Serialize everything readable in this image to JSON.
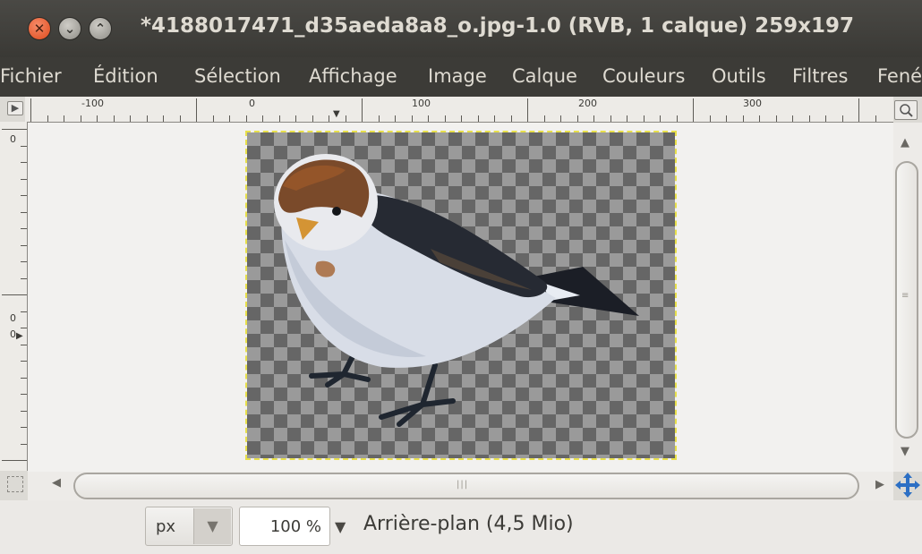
{
  "window": {
    "title": "*4188017471_d35aeda8a8_o.jpg-1.0 (RVB, 1 calque) 259x197",
    "buttons": [
      "close",
      "minimize",
      "maximize"
    ]
  },
  "menubar": {
    "items": [
      "Fichier",
      "Édition",
      "Sélection",
      "Affichage",
      "Image",
      "Calque",
      "Couleurs",
      "Outils",
      "Filtres",
      "Fené"
    ]
  },
  "rulers": {
    "horizontal_labels": [
      "-100",
      "0",
      "100",
      "200",
      "300"
    ],
    "vertical_labels": [
      "0",
      "0",
      "0"
    ]
  },
  "statusbar": {
    "unit": "px",
    "zoom": "100 %",
    "layer_info": "Arrière-plan (4,5 Mio)"
  },
  "canvas": {
    "layer_content": "bird photo on transparent background"
  },
  "colors": {
    "titlebar_bg": "#3c3b37",
    "close_button": "#df4a1b",
    "selection_outline": "#e8e04a"
  }
}
